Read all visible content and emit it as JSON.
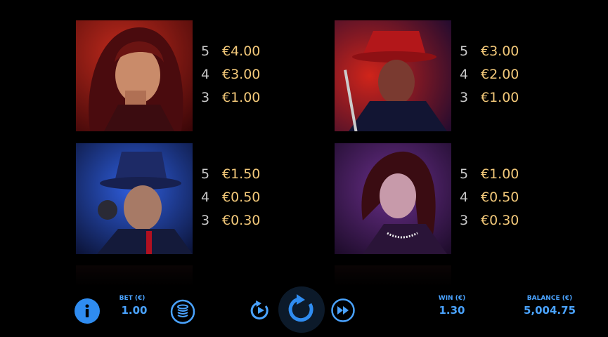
{
  "symbols": [
    {
      "icon": "red-haired-woman-symbol",
      "pays": [
        {
          "count": "5",
          "value": "€4.00"
        },
        {
          "count": "4",
          "value": "€3.00"
        },
        {
          "count": "3",
          "value": "€1.00"
        }
      ]
    },
    {
      "icon": "man-red-fedora-symbol",
      "pays": [
        {
          "count": "5",
          "value": "€3.00"
        },
        {
          "count": "4",
          "value": "€2.00"
        },
        {
          "count": "3",
          "value": "€1.00"
        }
      ]
    },
    {
      "icon": "gangster-gun-symbol",
      "pays": [
        {
          "count": "5",
          "value": "€1.50"
        },
        {
          "count": "4",
          "value": "€0.50"
        },
        {
          "count": "3",
          "value": "€0.30"
        }
      ]
    },
    {
      "icon": "woman-pearls-symbol",
      "pays": [
        {
          "count": "5",
          "value": "€1.00"
        },
        {
          "count": "4",
          "value": "€0.50"
        },
        {
          "count": "3",
          "value": "€0.30"
        }
      ]
    }
  ],
  "bottom_bar": {
    "bet_label": "BET (€)",
    "bet_value": "1.00",
    "win_label": "WIN (€)",
    "win_value": "1.30",
    "balance_label": "BALANCE (€)",
    "balance_value": "5,004.75",
    "icons": [
      "info-icon",
      "coin-stack-icon",
      "autoplay-icon",
      "spin-icon",
      "turbo-icon"
    ]
  },
  "colors": {
    "accent": "#4aa3ff",
    "pay_value": "#f3c97a"
  }
}
